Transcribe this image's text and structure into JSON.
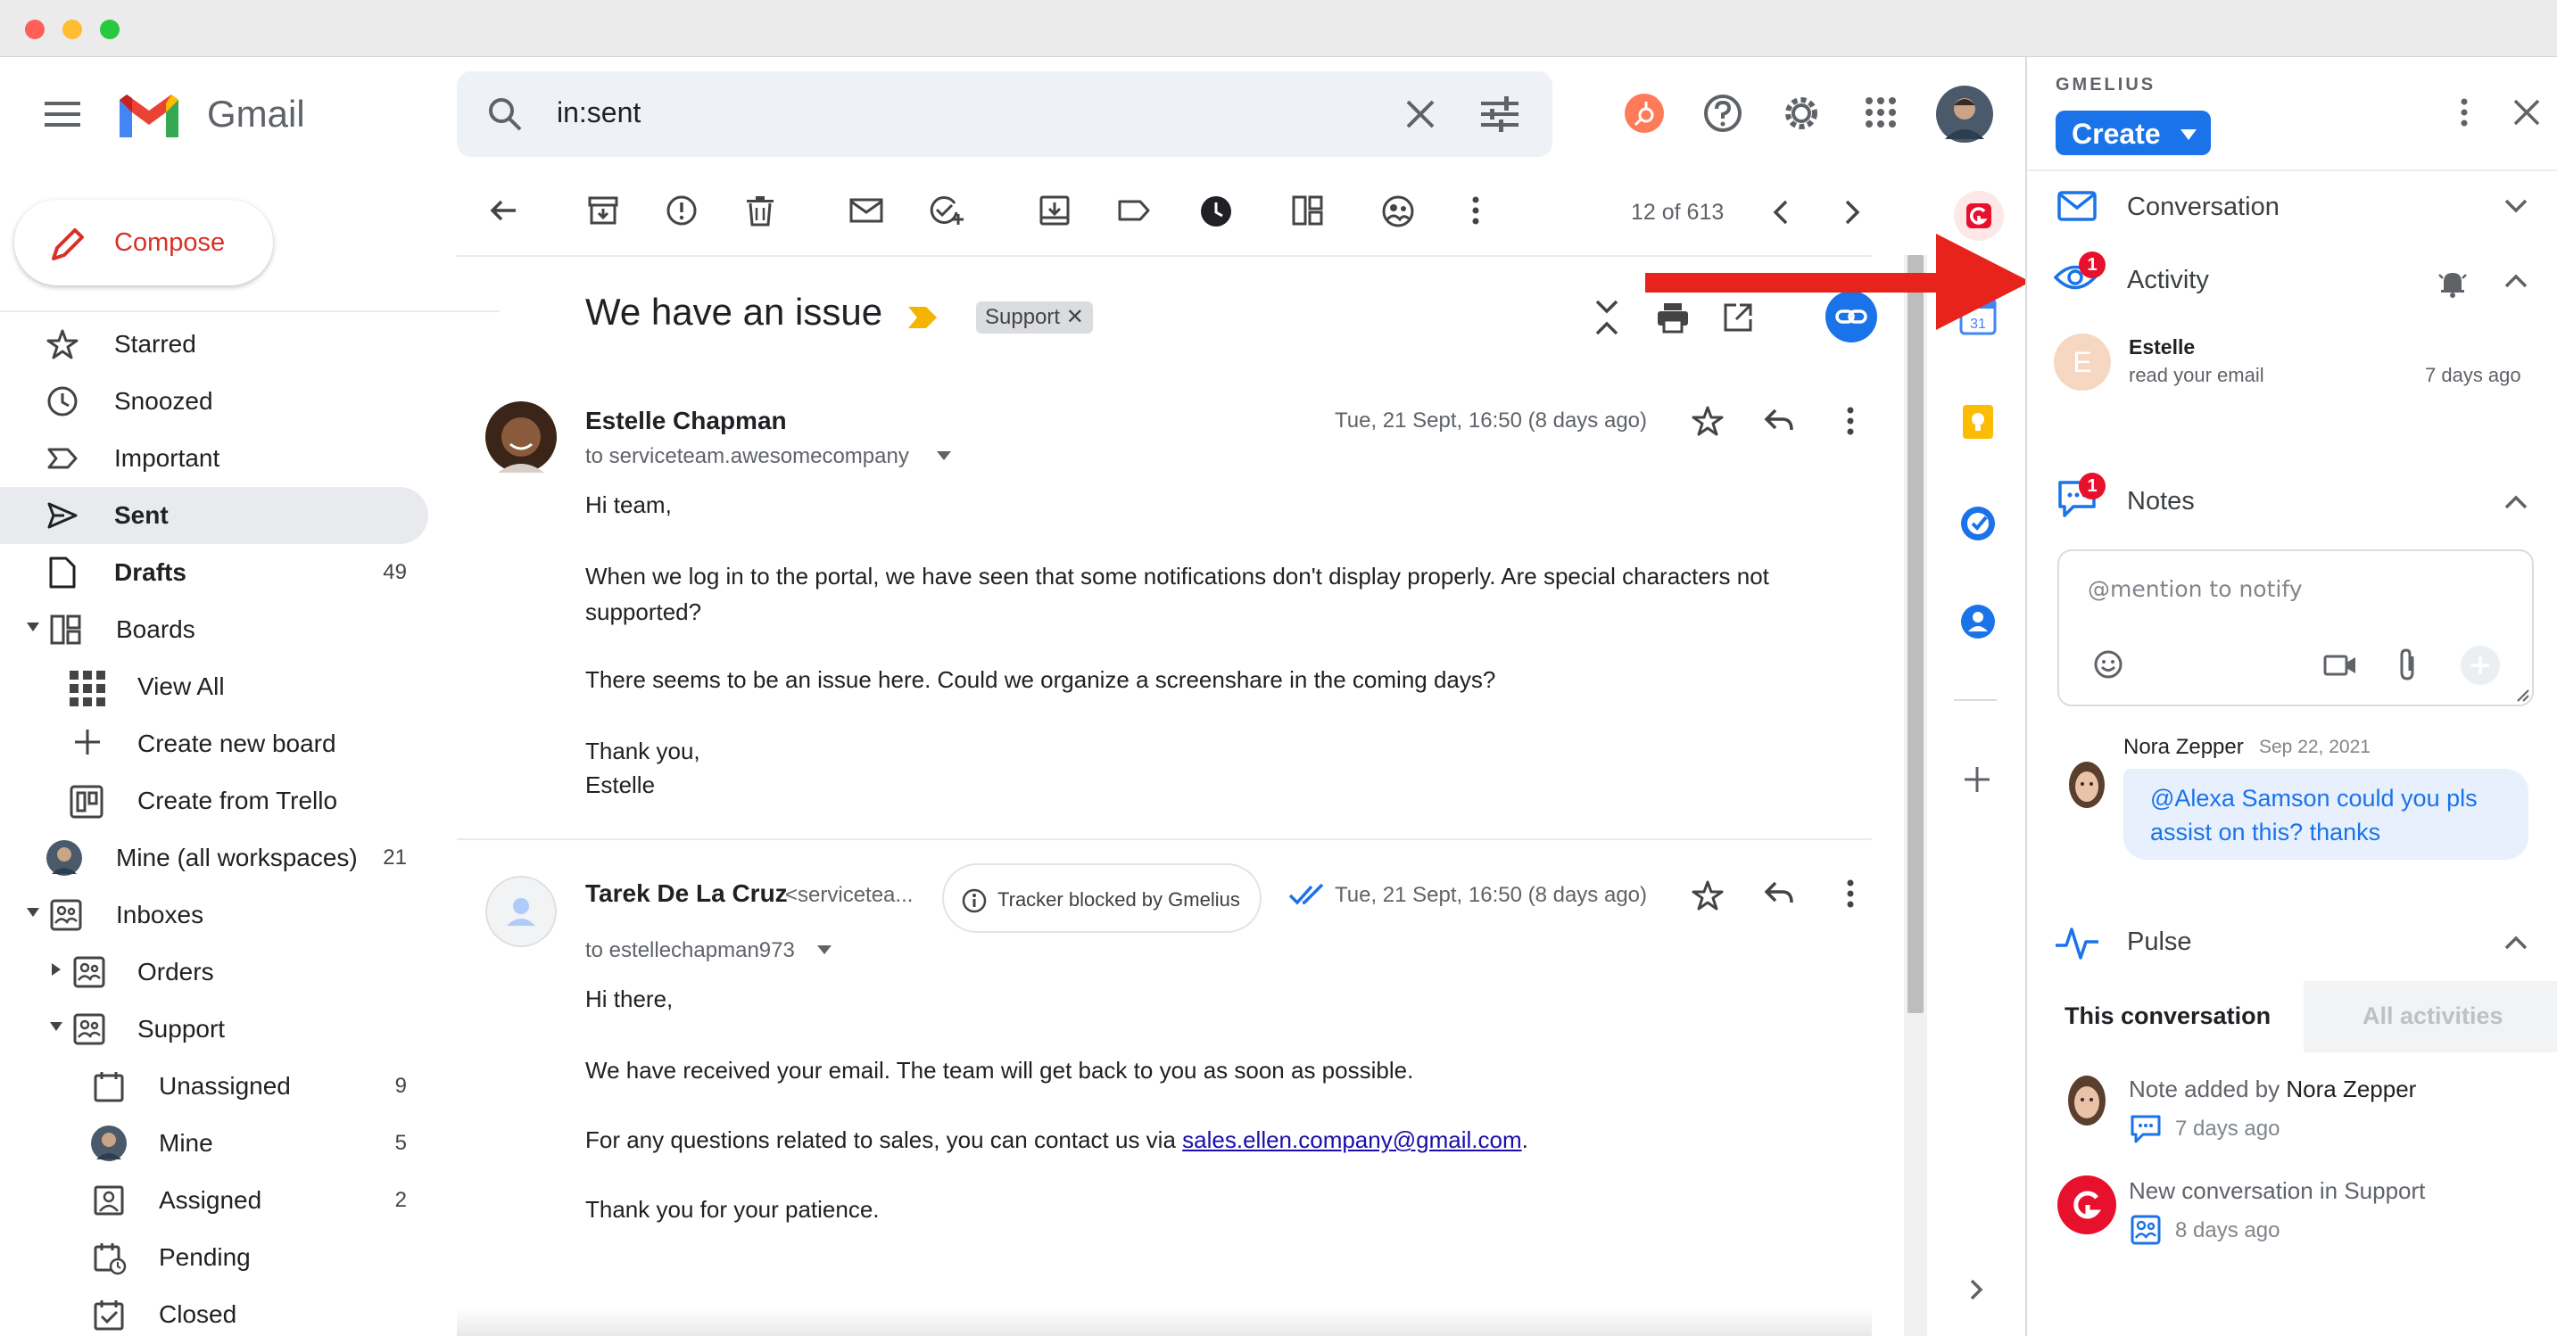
{
  "header": {
    "app_name": "Gmail",
    "search_query": "in:sent"
  },
  "compose": {
    "label": "Compose"
  },
  "nav": {
    "starred": "Starred",
    "snoozed": "Snoozed",
    "important": "Important",
    "sent": "Sent",
    "drafts": "Drafts",
    "drafts_count": "49",
    "boards": "Boards",
    "view_all": "View All",
    "create_board": "Create new board",
    "create_trello": "Create from Trello",
    "mine_all": "Mine (all workspaces)",
    "mine_all_count": "21",
    "inboxes": "Inboxes",
    "orders": "Orders",
    "support": "Support",
    "unassigned": "Unassigned",
    "unassigned_count": "9",
    "mine": "Mine",
    "mine_count": "5",
    "assigned": "Assigned",
    "assigned_count": "2",
    "pending": "Pending",
    "closed": "Closed"
  },
  "toolbar": {
    "pagination": "12 of 613"
  },
  "thread": {
    "subject": "We have an issue",
    "label_chip": "Support"
  },
  "message1": {
    "sender": "Estelle Chapman",
    "to": "to serviceteam.awesomecompany",
    "date": "Tue, 21 Sept, 16:50 (8 days ago)",
    "greeting": "Hi team,",
    "p1": "When we log in to the portal, we have seen that some notifications don't display properly. Are special characters not",
    "p1b": "supported?",
    "p2": "There seems to be an issue here. Could we organize a screenshare in the coming days?",
    "sign1": "Thank you,",
    "sign2": "Estelle"
  },
  "message2": {
    "sender": "Tarek De La Cruz",
    "sender_email": "<servicetea...",
    "tracker": "Tracker blocked by Gmelius",
    "date": "Tue, 21 Sept, 16:50 (8 days ago)",
    "to": "to estellechapman973",
    "greeting": "Hi there,",
    "p1": "We have received your email. The team will get back to you as soon as possible.",
    "p2_pre": "For any questions related to sales, you can contact us via ",
    "p2_link": "sales.ellen.company@gmail.com",
    "p2_post": ".",
    "p3": "Thank you for your patience."
  },
  "gmelius": {
    "brand": "GMELIUS",
    "create_label": "Create",
    "conversation": "Conversation",
    "activity": "Activity",
    "activity_badge": "1",
    "activity_user_initial": "E",
    "activity_user": "Estelle",
    "activity_action": "read your email",
    "activity_time": "7 days ago",
    "notes": "Notes",
    "notes_badge": "1",
    "notes_placeholder": "@mention to notify",
    "note_author": "Nora Zepper",
    "note_date": "Sep 22, 2021",
    "note_text1": "@Alexa Samson could you pls",
    "note_text2": "assist on this? thanks",
    "pulse": "Pulse",
    "tab_this": "This conversation",
    "tab_all": "All activities",
    "pulse1_pre": "Note added by ",
    "pulse1_name": "Nora Zepper",
    "pulse1_time": "7 days ago",
    "pulse2": "New conversation in Support",
    "pulse2_time": "8 days ago"
  },
  "colors": {
    "gmelius_blue": "#1a73e8",
    "red_arrow": "#e8231c",
    "compose_red": "#d93025"
  }
}
